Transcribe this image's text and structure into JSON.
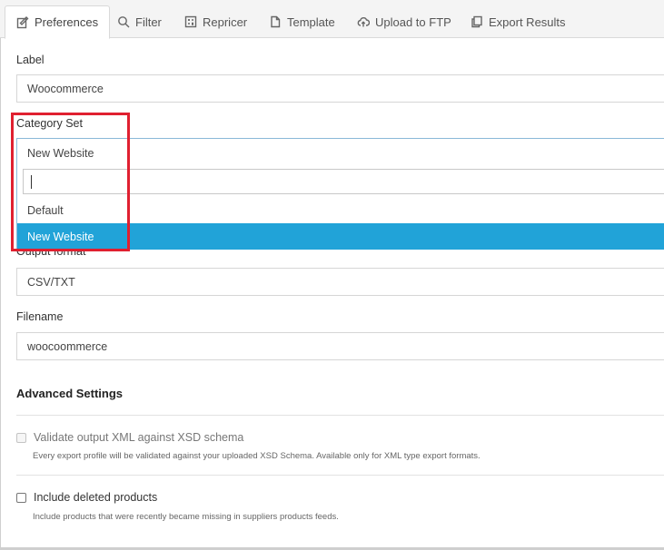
{
  "tabs": [
    {
      "label": "Preferences",
      "icon": "edit-icon",
      "active": true
    },
    {
      "label": "Filter",
      "icon": "search-icon"
    },
    {
      "label": "Repricer",
      "icon": "calculator-icon"
    },
    {
      "label": "Template",
      "icon": "document-icon"
    },
    {
      "label": "Upload to FTP",
      "icon": "cloud-upload-icon"
    },
    {
      "label": "Export Results",
      "icon": "copy-icon"
    }
  ],
  "form": {
    "label_label": "Label",
    "label_value": "Woocommerce",
    "category_set_label": "Category Set",
    "category_set_value": "New Website",
    "category_set_search": "",
    "category_set_options": [
      "Default",
      "New Website"
    ],
    "category_set_highlighted": "New Website",
    "output_format_label": "Output format",
    "output_format_value": "CSV/TXT",
    "filename_label": "Filename",
    "filename_value": "woocoommerce"
  },
  "advanced": {
    "title": "Advanced Settings",
    "validate_label": "Validate output XML against XSD schema",
    "validate_help": "Every export profile will be validated against your uploaded XSD Schema. Available only for XML type export formats.",
    "validate_checked": false,
    "validate_disabled": true,
    "deleted_label": "Include deleted products",
    "deleted_help": "Include products that were recently became missing in suppliers products feeds.",
    "deleted_checked": false
  },
  "colors": {
    "highlight": "#21a3d8",
    "annotation_box": "#e02030"
  }
}
